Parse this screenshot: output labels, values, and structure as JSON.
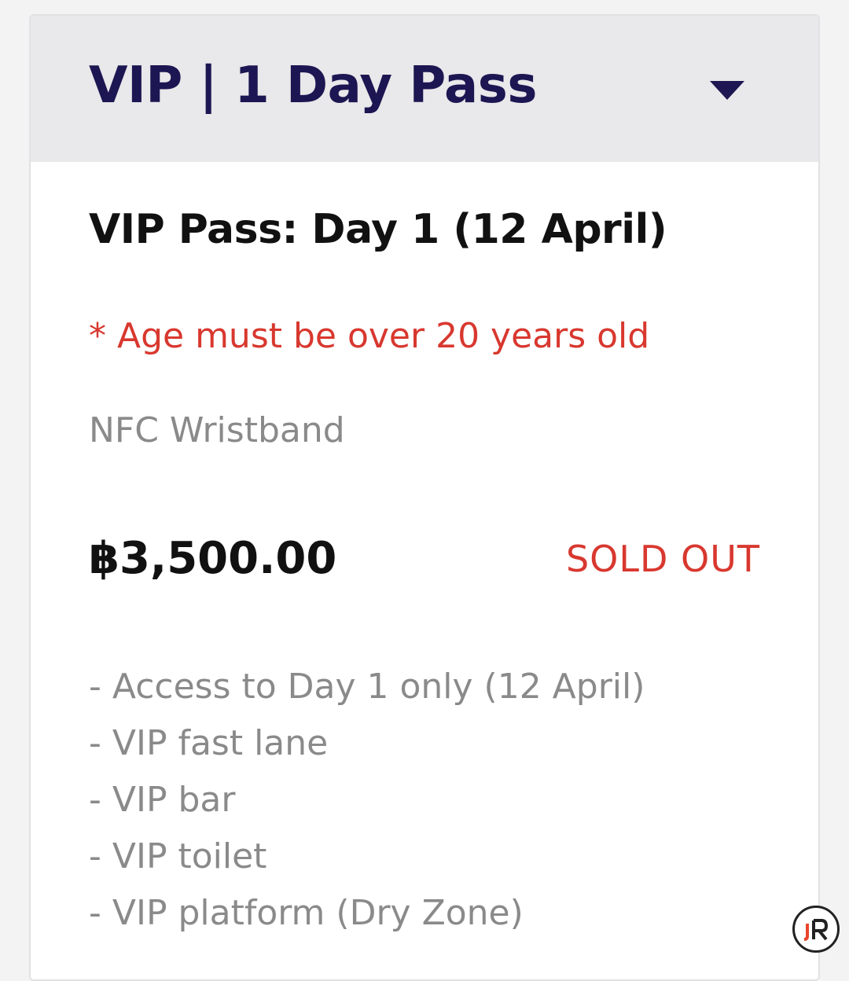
{
  "ticket": {
    "title": "VIP | 1 Day Pass",
    "expand_icon": "caret-down-icon",
    "pass_name": "VIP Pass: Day 1 (12 April)",
    "age_note": "* Age must be over 20 years old",
    "item_type": "NFC Wristband",
    "price": "฿3,500.00",
    "status": "SOLD OUT",
    "features": [
      "- Access to Day 1 only (12 April)",
      "- VIP fast lane",
      "- VIP bar",
      "- VIP toilet",
      "- VIP platform (Dry Zone)"
    ]
  },
  "colors": {
    "header_bg": "#e9e8ea",
    "title": "#1c1652",
    "alert": "#d8382f",
    "muted": "#8a8a8a"
  }
}
